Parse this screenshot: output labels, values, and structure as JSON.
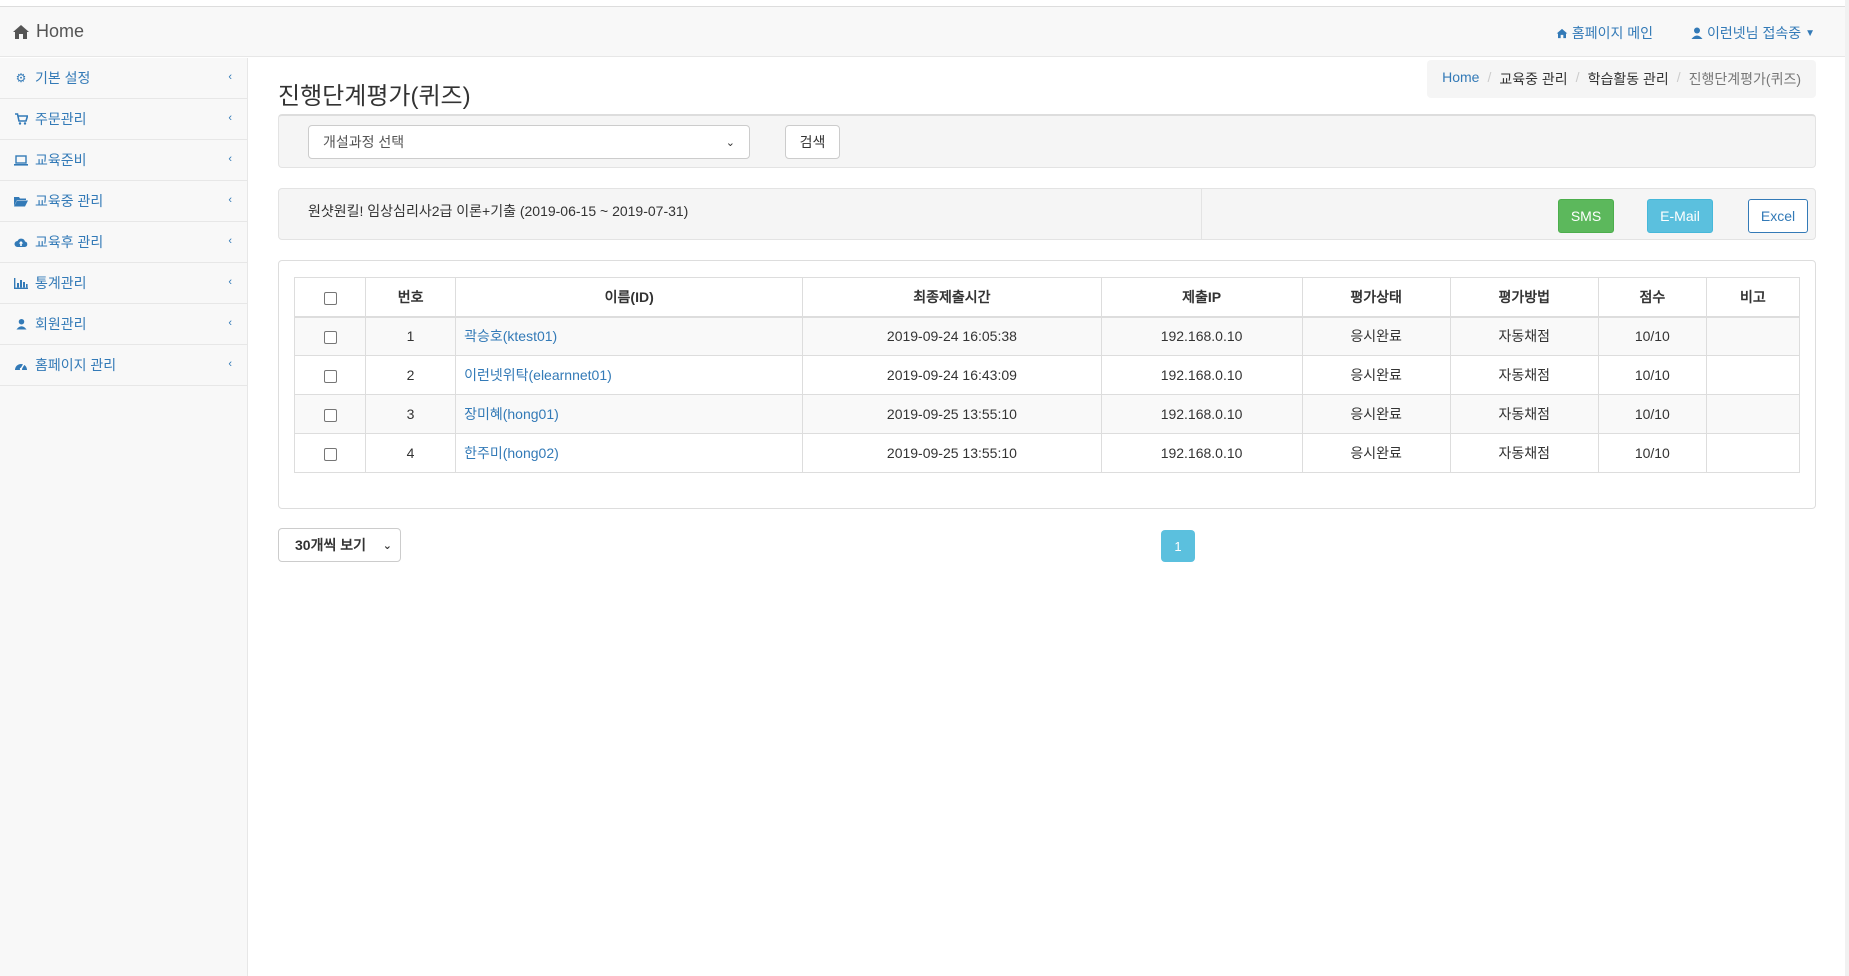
{
  "navbar": {
    "brand": "Home",
    "homepage_link": "홈페이지 메인",
    "user_status": "이런넷님 접속중"
  },
  "sidebar": {
    "items": [
      {
        "label": "기본 설정",
        "icon": "gears-icon"
      },
      {
        "label": "주문관리",
        "icon": "cart-icon"
      },
      {
        "label": "교육준비",
        "icon": "laptop-icon"
      },
      {
        "label": "교육중 관리",
        "icon": "folder-open-icon"
      },
      {
        "label": "교육후 관리",
        "icon": "cloud-upload-icon"
      },
      {
        "label": "통계관리",
        "icon": "bar-chart-icon"
      },
      {
        "label": "회원관리",
        "icon": "user-icon"
      },
      {
        "label": "홈페이지 관리",
        "icon": "dashboard-icon"
      }
    ]
  },
  "page": {
    "title": "진행단계평가(퀴즈)",
    "breadcrumb": [
      "Home",
      "교육중 관리",
      "학습활동 관리",
      "진행단계평가(퀴즈)"
    ]
  },
  "search": {
    "course_select": "개설과정 선택",
    "search_button": "검색"
  },
  "info": {
    "course_text": "원샷원킬! 임상심리사2급 이론+기출 (2019-06-15 ~ 2019-07-31)",
    "sms_button": "SMS",
    "email_button": "E-Mail",
    "excel_button": "Excel"
  },
  "table": {
    "headers": [
      "번호",
      "이름(ID)",
      "최종제출시간",
      "제출IP",
      "평가상태",
      "평가방법",
      "점수",
      "비고"
    ],
    "rows": [
      {
        "no": "1",
        "name": "곽승호(ktest01)",
        "time": "2019-09-24 16:05:38",
        "ip": "192.168.0.10",
        "status": "응시완료",
        "method": "자동채점",
        "score": "10/10",
        "note": ""
      },
      {
        "no": "2",
        "name": "이런넷위탁(elearnnet01)",
        "time": "2019-09-24 16:43:09",
        "ip": "192.168.0.10",
        "status": "응시완료",
        "method": "자동채점",
        "score": "10/10",
        "note": ""
      },
      {
        "no": "3",
        "name": "장미혜(hong01)",
        "time": "2019-09-25 13:55:10",
        "ip": "192.168.0.10",
        "status": "응시완료",
        "method": "자동채점",
        "score": "10/10",
        "note": ""
      },
      {
        "no": "4",
        "name": "한주미(hong02)",
        "time": "2019-09-25 13:55:10",
        "ip": "192.168.0.10",
        "status": "응시완료",
        "method": "자동채점",
        "score": "10/10",
        "note": ""
      }
    ]
  },
  "pagination": {
    "per_page": "30개씩 보기",
    "current_page": "1"
  }
}
